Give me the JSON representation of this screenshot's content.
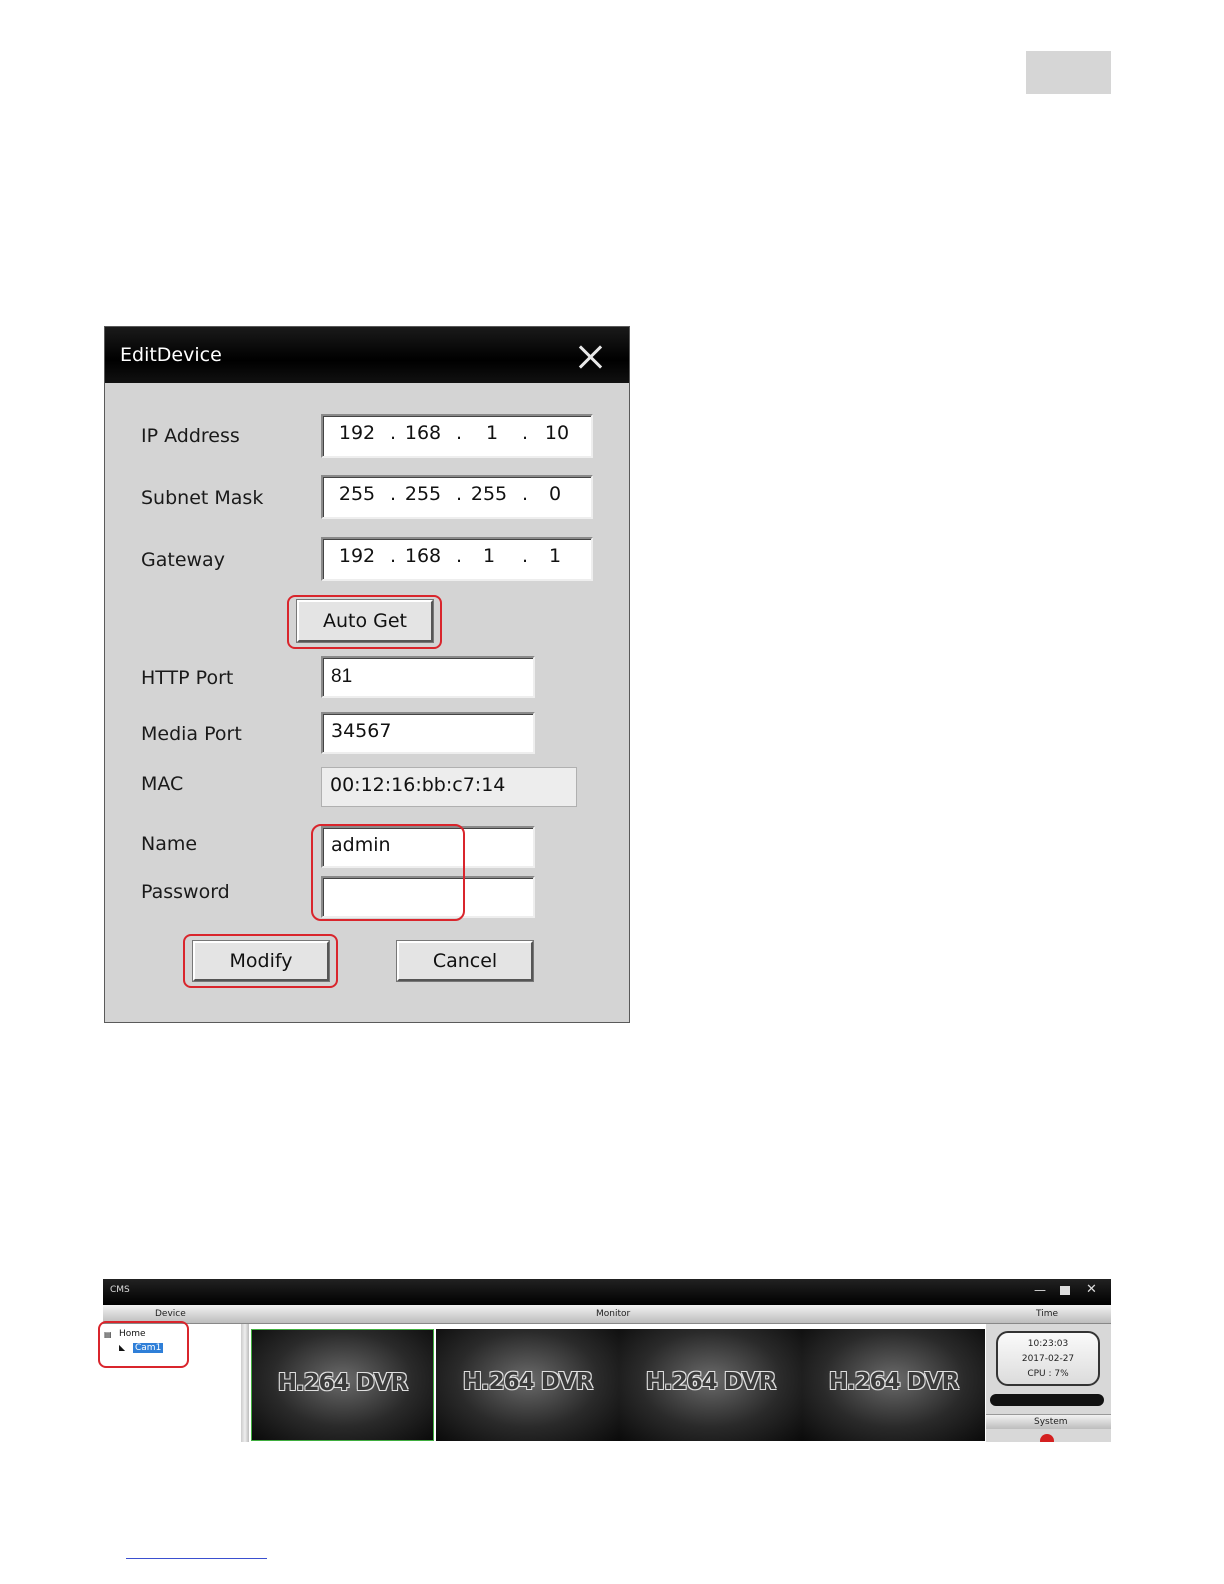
{
  "dialog": {
    "title": "EditDevice",
    "labels": {
      "ip": "IP Address",
      "subnet": "Subnet Mask",
      "gateway": "Gateway",
      "http": "HTTP Port",
      "media": "Media Port",
      "mac": "MAC",
      "name": "Name",
      "password": "Password"
    },
    "ip": [
      "192",
      "168",
      "1",
      "10"
    ],
    "subnet": [
      "255",
      "255",
      "255",
      "0"
    ],
    "gateway": [
      "192",
      "168",
      "1",
      "1"
    ],
    "dot": ".",
    "auto_get": "Auto Get",
    "http_port": "81",
    "media_port": "34567",
    "mac": "00:12:16:bb:c7:14",
    "name": "admin",
    "password": "",
    "modify": "Modify",
    "cancel": "Cancel"
  },
  "cms": {
    "title": "CMS",
    "window_controls": {
      "minimize": "—",
      "close": "✕"
    },
    "headers": {
      "device": "Device",
      "monitor": "Monitor",
      "time": "Time"
    },
    "tree": {
      "home": "Home",
      "cam": "Cam1"
    },
    "tiles": [
      "H.264 DVR",
      "H.264 DVR",
      "H.264 DVR",
      "H.264 DVR"
    ],
    "clock": {
      "time": "10:23:03",
      "date": "2017-02-27",
      "cpu": "CPU : 7%"
    },
    "system": "System"
  },
  "colors": {
    "highlight": "#d9252c",
    "selection": "#2f7fd8"
  }
}
